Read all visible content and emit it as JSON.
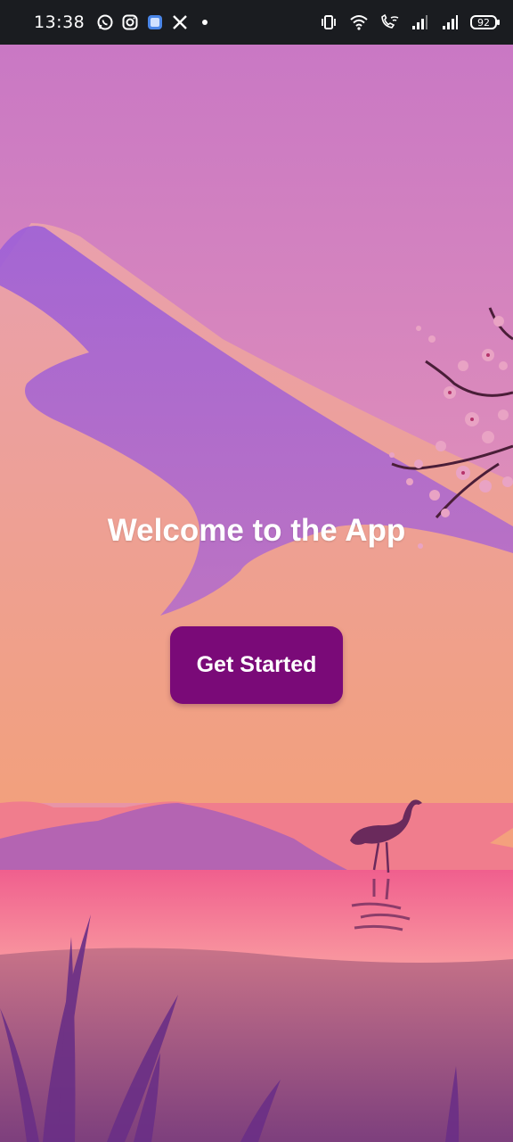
{
  "status_bar": {
    "time": "13:38",
    "notification_icons": [
      "whatsapp-icon",
      "instagram-icon",
      "app-icon",
      "x-icon",
      "dot-icon"
    ],
    "system_icons": [
      "vibrate-icon",
      "wifi-icon",
      "wifi-calling-icon",
      "signal-icon",
      "signal-icon"
    ],
    "battery_level": "92"
  },
  "main": {
    "title": "Welcome to the App",
    "cta_label": "Get Started"
  },
  "colors": {
    "button_bg": "#7a0a78",
    "status_bar_bg": "#1a1c20",
    "sky_top": "#c978c4",
    "water": "#f3738e"
  }
}
